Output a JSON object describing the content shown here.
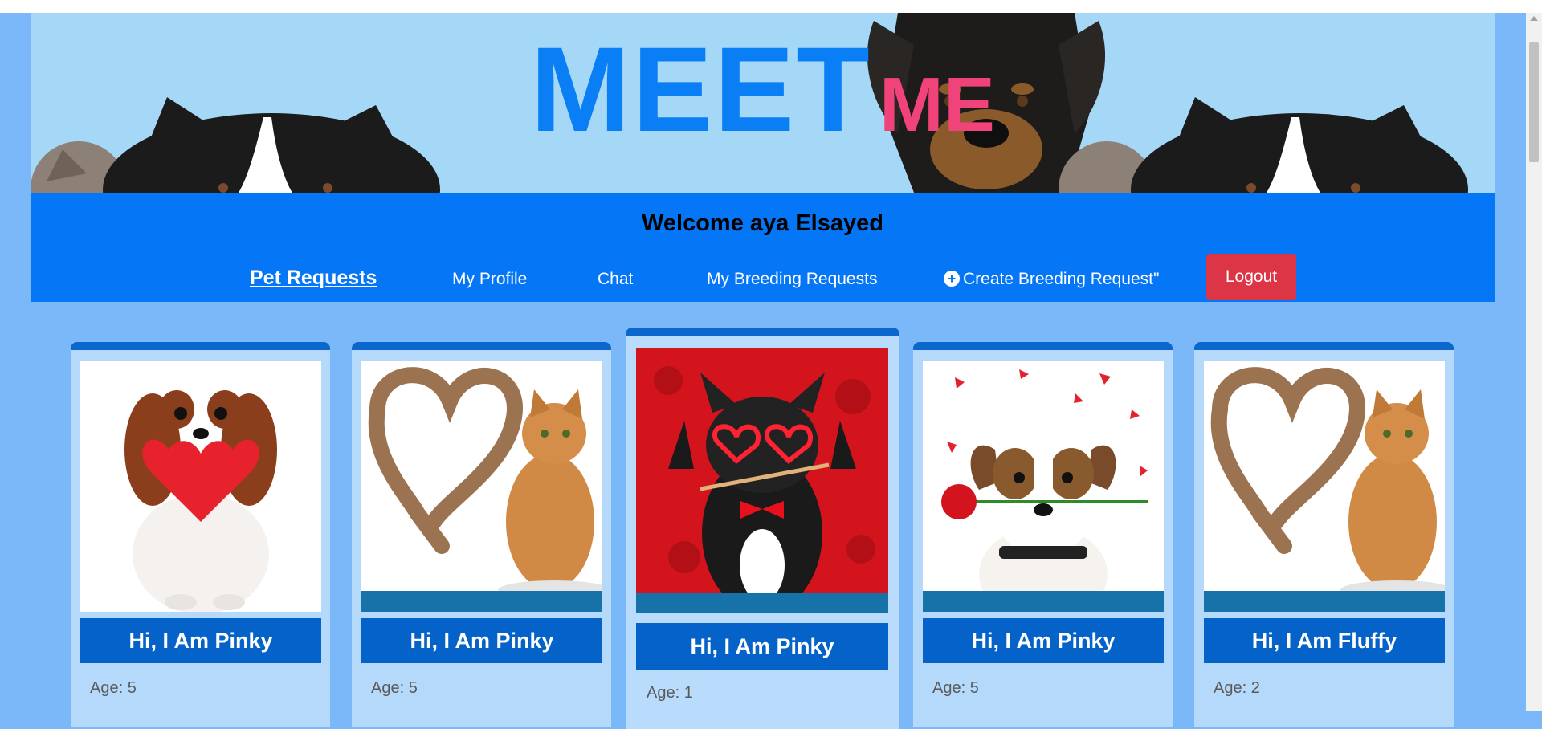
{
  "header": {
    "logo_main": "MEET",
    "logo_accent": "ME"
  },
  "nav": {
    "welcome": "Welcome aya Elsayed",
    "items": [
      {
        "label": "Pet Requests",
        "active": true
      },
      {
        "label": "My Profile"
      },
      {
        "label": "Chat"
      },
      {
        "label": "My Breeding Requests"
      },
      {
        "label": "Create Breeding Request\"",
        "icon": "plus-circle-icon"
      }
    ],
    "logout": "Logout"
  },
  "cards": [
    {
      "title": "Hi, I Am Pinky",
      "age": "Age: 5",
      "photo": "dog-with-heart"
    },
    {
      "title": "Hi, I Am Pinky",
      "age": "Age: 5",
      "photo": "cat-heart-tail"
    },
    {
      "title": "Hi, I Am Pinky",
      "age": "Age: 1",
      "photo": "bulldog-heart-glasses"
    },
    {
      "title": "Hi, I Am Pinky",
      "age": "Age: 5",
      "photo": "terrier-with-rose"
    },
    {
      "title": "Hi, I Am Fluffy",
      "age": "Age: 2",
      "photo": "cat-heart-tail"
    }
  ],
  "colors": {
    "page_bg": "#7ab8fa",
    "header_bg": "#a5d8f7",
    "nav_bg": "#0576f5",
    "logo_blue": "#0a7ef5",
    "logo_pink": "#f0437a",
    "logout_bg": "#dc3545",
    "card_title_bg": "#0562c8"
  }
}
